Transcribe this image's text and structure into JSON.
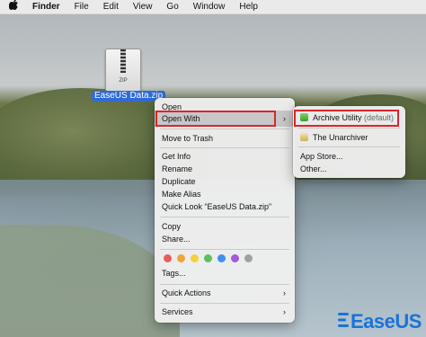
{
  "menubar": {
    "apple_icon": "apple-logo-icon",
    "items": [
      "Finder",
      "File",
      "Edit",
      "View",
      "Go",
      "Window",
      "Help"
    ]
  },
  "desktop": {
    "file": {
      "name": "EaseUS Data.zip",
      "icon_text": "ZIP",
      "icon": "zip-archive-icon"
    }
  },
  "context_menu": {
    "open": "Open",
    "open_with": "Open With",
    "move_to_trash": "Move to Trash",
    "get_info": "Get Info",
    "rename": "Rename",
    "duplicate": "Duplicate",
    "make_alias": "Make Alias",
    "quick_look": "Quick Look “EaseUS Data.zip”",
    "copy": "Copy",
    "share": "Share...",
    "tags": "Tags...",
    "quick_actions": "Quick Actions",
    "services": "Services",
    "tag_colors": [
      "#e85c5c",
      "#f0a33a",
      "#f2d23a",
      "#5cc15c",
      "#3f8ff0",
      "#a45ad8",
      "#a0a0a0"
    ],
    "highlight_color": "#c7c7c7",
    "annotation_color": "#d9262c"
  },
  "open_with_submenu": {
    "archive_utility": "Archive Utility",
    "archive_default": "(default)",
    "the_unarchiver": "The Unarchiver",
    "app_store": "App Store...",
    "other": "Other..."
  },
  "watermark": {
    "text": "EaseUS",
    "color": "#1a73d9"
  }
}
